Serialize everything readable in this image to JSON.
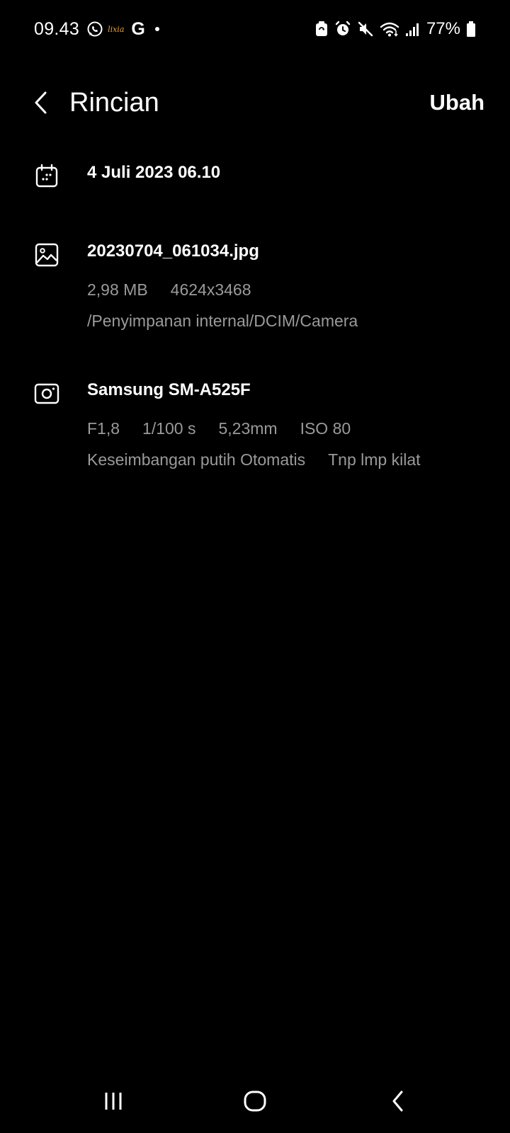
{
  "status_bar": {
    "time": "09.43",
    "lixia_label": "lixia",
    "google_label": "G",
    "battery_percent": "77%",
    "icons": [
      "whatsapp-icon",
      "lixia-icon",
      "google-icon",
      "notification-dot-icon",
      "battery-saver-icon",
      "alarm-icon",
      "mute-icon",
      "wifi-icon",
      "signal-icon",
      "battery-icon"
    ]
  },
  "app_bar": {
    "title": "Rincian",
    "edit_label": "Ubah"
  },
  "date_section": {
    "icon": "calendar-icon",
    "datetime": "4 Juli 2023 06.10"
  },
  "file_section": {
    "icon": "image-icon",
    "filename": "20230704_061034.jpg",
    "size": "2,98 MB",
    "resolution": "4624x3468",
    "path": "/Penyimpanan internal/DCIM/Camera"
  },
  "camera_section": {
    "icon": "camera-icon",
    "model": "Samsung SM-A525F",
    "aperture": "F1,8",
    "shutter": "1/100 s",
    "focal_length": "5,23mm",
    "iso": "ISO 80",
    "white_balance": "Keseimbangan putih Otomatis",
    "flash": "Tnp lmp kilat"
  },
  "nav_bar": {
    "icons": [
      "recent-apps-icon",
      "home-icon",
      "back-icon"
    ]
  },
  "colors": {
    "background": "#000000",
    "primary_text": "#ffffff",
    "secondary_text": "#9a9a9a",
    "accent_lixia": "#e8a235"
  }
}
